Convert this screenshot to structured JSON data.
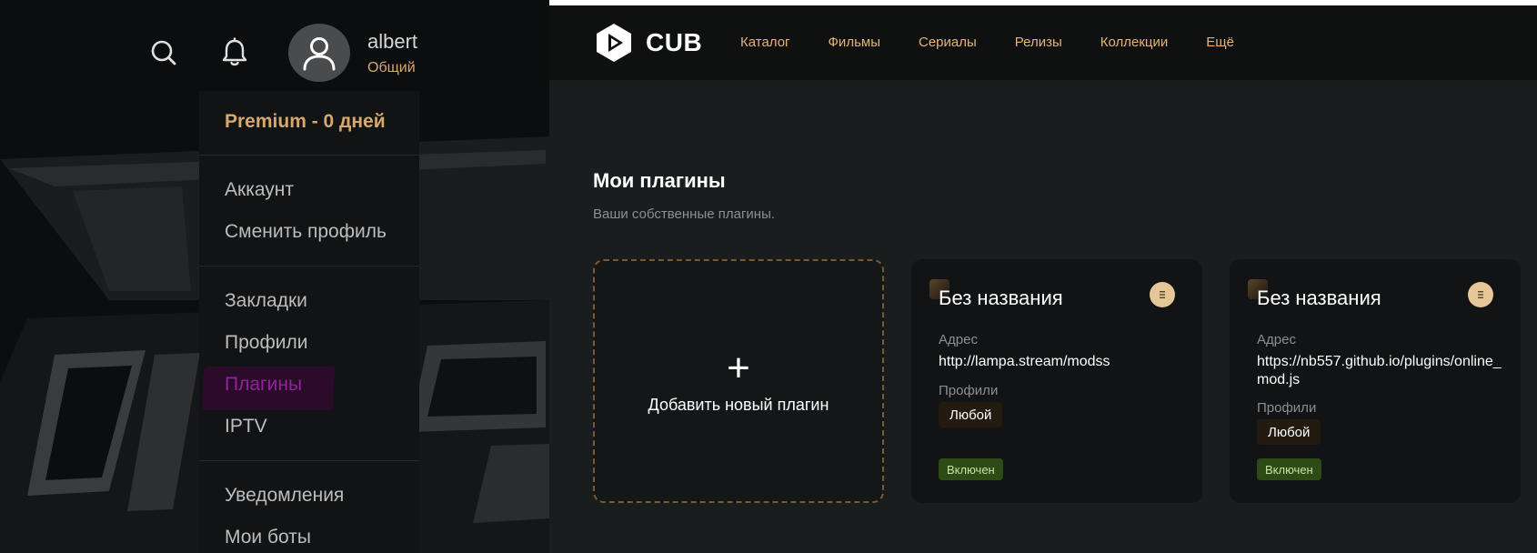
{
  "left_panel": {
    "user": {
      "name": "albert",
      "role": "Общий"
    },
    "menu": {
      "premium": "Premium - 0 дней",
      "items": [
        {
          "label": "Аккаунт"
        },
        {
          "label": "Сменить профиль"
        },
        {
          "label": "Закладки"
        },
        {
          "label": "Профили"
        },
        {
          "label": "Плагины"
        },
        {
          "label": "IPTV"
        },
        {
          "label": "Уведомления"
        },
        {
          "label": "Мои боты"
        }
      ]
    },
    "icons": {
      "search": "search-icon",
      "bell": "bell-icon",
      "avatar": "user-icon"
    }
  },
  "right_panel": {
    "logo_text": "CUB",
    "nav": [
      {
        "label": "Каталог"
      },
      {
        "label": "Фильмы"
      },
      {
        "label": "Сериалы"
      },
      {
        "label": "Релизы"
      },
      {
        "label": "Коллекции"
      },
      {
        "label": "Ещё"
      }
    ],
    "section": {
      "title": "Мои плагины",
      "subtitle": "Ваши собственные плагины."
    },
    "add_card": {
      "plus": "+",
      "label": "Добавить новый плагин"
    },
    "plugins": [
      {
        "title": "Без названия",
        "address_label": "Адрес",
        "address": "http://lampa.stream/modss",
        "profiles_label": "Профили",
        "profile": "Любой",
        "status": "Включен"
      },
      {
        "title": "Без названия",
        "address_label": "Адрес",
        "address": "https://nb557.github.io/plugins/online_mod.js",
        "profiles_label": "Профили",
        "profile": "Любой",
        "status": "Включен"
      }
    ]
  },
  "colors": {
    "accent": "#d7a86e",
    "nav_text": "#e6b27a",
    "highlight_plugins": "#9a1ea0",
    "status_green": "#2c4b17",
    "card_bg": "#111314"
  }
}
